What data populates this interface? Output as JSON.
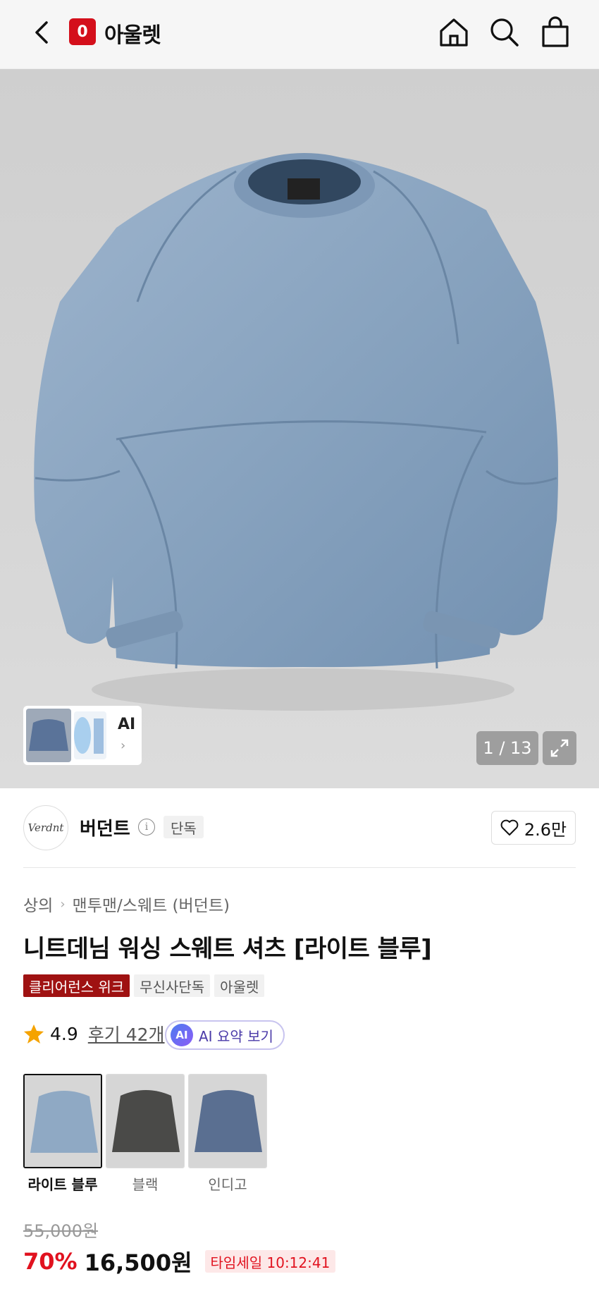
{
  "header": {
    "logo_letter": "0",
    "logo_text": "아울렛",
    "icons": [
      "back-icon",
      "home-icon",
      "search-icon",
      "shopping-bag-icon"
    ]
  },
  "gallery": {
    "counter": "1 / 13",
    "ai_label": "AI",
    "ai_arrow": "›"
  },
  "brand": {
    "logo_text": "Verdnt",
    "name": "버던트",
    "info_glyph": "i",
    "exclusive_tag": "단독",
    "likes": "2.6만"
  },
  "product": {
    "category_main": "상의",
    "category_sep": "›",
    "category_sub": "맨투맨/스웨트 (버던트)",
    "title": "니트데님 워싱 스웨트 셔츠 [라이트 블루]",
    "tags": [
      {
        "label": "클리어런스 위크",
        "style": "red"
      },
      {
        "label": "무신사단독",
        "style": "gray"
      },
      {
        "label": "아울렛",
        "style": "gray"
      }
    ],
    "rating": "4.9",
    "reviews": "후기 42개",
    "ai_summary_badge": "AI",
    "ai_summary_label": "AI 요약 보기"
  },
  "colors": [
    {
      "label": "라이트 블루",
      "selected": true,
      "swatch": "#8fa9c4"
    },
    {
      "label": "블랙",
      "selected": false,
      "swatch": "#4a4a48"
    },
    {
      "label": "인디고",
      "selected": false,
      "swatch": "#5a6f91"
    }
  ],
  "price": {
    "original": "55,000원",
    "discount": "70%",
    "final": "16,500원",
    "timesale": "타임세일 10:12:41"
  },
  "theme": {
    "accent_red": "#e1121f",
    "brand_red": "#d40f1b",
    "clearance_red": "#9f1212"
  }
}
